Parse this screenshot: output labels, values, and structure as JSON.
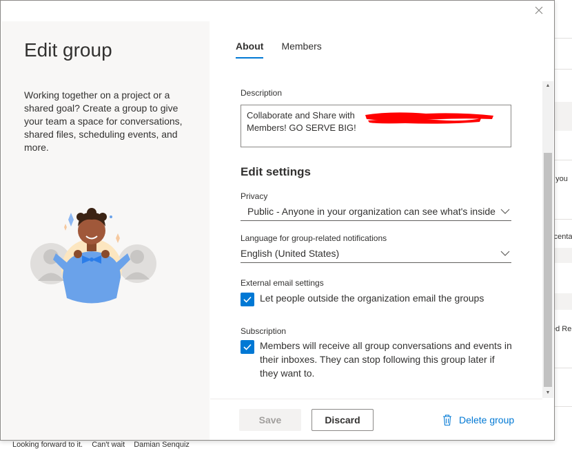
{
  "dialog": {
    "title": "Edit group",
    "description": "Working together on a project or a shared goal? Create a group to give your team a space for conversations, shared files, scheduling events, and more."
  },
  "tabs": [
    {
      "label": "About",
      "active": true
    },
    {
      "label": "Members",
      "active": false
    }
  ],
  "about": {
    "description_label": "Description",
    "description_value": "Collaborate and Share with ██████████████ Members! GO SERVE BIG!",
    "description_line1": "Collaborate and Share with",
    "description_line2": "Members! GO SERVE BIG!",
    "edit_settings_title": "Edit settings",
    "privacy_label": "Privacy",
    "privacy_value": "Public - Anyone in your organization can see what's inside",
    "language_label": "Language for group-related notifications",
    "language_value": "English (United States)",
    "external_email_label": "External email settings",
    "external_email_text": "Let people outside the organization email the groups",
    "external_email_checked": true,
    "subscription_label": "Subscription",
    "subscription_text": "Members will receive all group conversations and events in their inboxes. They can stop following this group later if they want to.",
    "subscription_checked": true
  },
  "footer": {
    "save_label": "Save",
    "discard_label": "Discard",
    "delete_label": "Delete group"
  },
  "background": {
    "right_snippets": [
      "f you",
      "rcenta",
      "ed Re"
    ],
    "bottom_texts": [
      "Looking forward to it.",
      "Can't wait",
      "Damian Senquiz"
    ]
  },
  "colors": {
    "accent": "#0078d4",
    "left_pane_bg": "#f8f7f6",
    "redaction": "#ff0000"
  },
  "icons": {
    "close": "close-icon",
    "chevron": "chevron-down-icon",
    "check": "checkmark-icon",
    "delete": "trash-icon"
  }
}
